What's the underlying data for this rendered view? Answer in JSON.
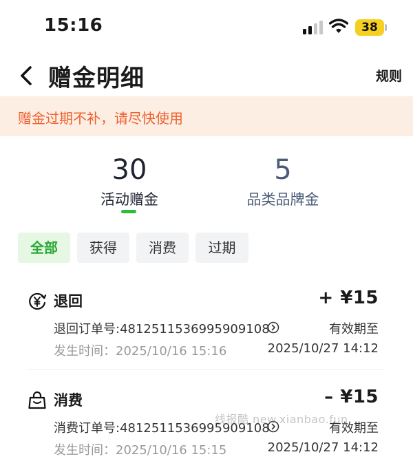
{
  "status_bar": {
    "time": "15:16",
    "battery": "38"
  },
  "header": {
    "title": "赠金明细",
    "rules": "规则"
  },
  "notice": "赠金过期不补，请尽快使用",
  "balances": [
    {
      "value": "30",
      "label": "活动赠金"
    },
    {
      "value": "5",
      "label": "品类品牌金"
    }
  ],
  "filters": [
    "全部",
    "获得",
    "消费",
    "过期"
  ],
  "records": [
    {
      "icon": "refund-yen-icon",
      "title": "退回",
      "amount": "+ ¥15",
      "order": "退回订单号:4812511536995909108",
      "time": "发生时间：2025/10/16 15:16",
      "expire_label": "有效期至",
      "expire_date": "2025/10/27 14:12"
    },
    {
      "icon": "shopping-bag-icon",
      "title": "消费",
      "amount": "– ¥15",
      "order": "消费订单号:4812511536995909108",
      "time": "发生时间：2025/10/16 15:15",
      "expire_label": "有效期至",
      "expire_date": "2025/10/27 14:12"
    }
  ],
  "watermark": "线报酷 new.xianbao.fun",
  "colors": {
    "accent": "#2bbd3c",
    "notice_text": "#f0602c",
    "notice_bg": "#fdeee4",
    "battery": "#f5d020"
  }
}
